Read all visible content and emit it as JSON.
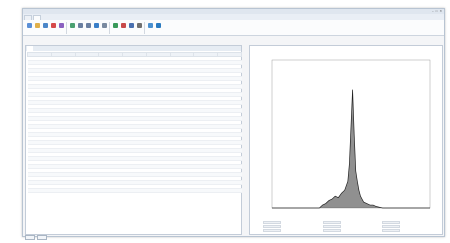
{
  "window": {
    "title": "",
    "controls": [
      "–",
      "□",
      "✕"
    ]
  },
  "tabs": [
    {
      "label": ""
    },
    {
      "label": ""
    }
  ],
  "ribbon": {
    "buttons": [
      {
        "icon": "open-icon",
        "color": "#5b8fd6",
        "label": ""
      },
      {
        "icon": "folder-icon",
        "color": "#e0b04a",
        "label": ""
      },
      {
        "icon": "table-icon",
        "color": "#4a86c8",
        "label": ""
      },
      {
        "icon": "chart-icon",
        "color": "#d64a4a",
        "label": ""
      },
      {
        "icon": "export-icon",
        "color": "#8a60c0",
        "label": ""
      },
      {
        "icon": "import-icon",
        "color": "#4aa070",
        "label": ""
      },
      {
        "icon": "add-icon",
        "color": "#6a7fa0",
        "label": ""
      },
      {
        "icon": "remove-icon",
        "color": "#6a7fa0",
        "label": ""
      },
      {
        "icon": "filter-icon",
        "color": "#3a7fc8",
        "label": ""
      },
      {
        "icon": "sort-icon",
        "color": "#7a8aa0",
        "label": ""
      },
      {
        "icon": "stats-icon",
        "color": "#3a9a5a",
        "label": ""
      },
      {
        "icon": "histogram-icon",
        "color": "#c84a4a",
        "label": ""
      },
      {
        "icon": "calc-icon",
        "color": "#4a70b0",
        "label": ""
      },
      {
        "icon": "print-icon",
        "color": "#707070",
        "label": ""
      },
      {
        "icon": "settings-icon",
        "color": "#4a90d0",
        "label": ""
      },
      {
        "icon": "help-icon",
        "color": "#2a7ac0",
        "label": ""
      }
    ]
  },
  "left_panel": {
    "subtabs": [
      "",
      ""
    ],
    "columns": [
      "",
      "",
      "",
      "",
      "",
      "",
      "",
      "",
      ""
    ],
    "rows": 34
  },
  "bottom": {
    "button1": "",
    "button2": ""
  },
  "right_panel": {
    "title": ""
  },
  "chart_data": {
    "type": "line",
    "title": "",
    "xlabel": "",
    "ylabel": "",
    "color": "#222222",
    "x_domain": [
      0,
      100
    ],
    "y_domain": [
      0,
      100
    ],
    "y_ticks": [],
    "x": [
      0,
      20,
      30,
      32,
      34,
      36,
      38,
      40,
      42,
      44,
      46,
      48,
      49,
      50,
      51,
      52,
      53,
      54,
      55,
      56,
      57,
      58,
      60,
      62,
      64,
      66,
      70,
      80,
      100
    ],
    "y": [
      0,
      0,
      0,
      2,
      3,
      5,
      6,
      8,
      7,
      10,
      12,
      18,
      30,
      55,
      80,
      50,
      25,
      18,
      12,
      8,
      6,
      4,
      3,
      2,
      2,
      1,
      0,
      0,
      0
    ]
  },
  "stats": [
    "",
    "",
    "",
    "",
    "",
    "",
    "",
    "",
    ""
  ]
}
